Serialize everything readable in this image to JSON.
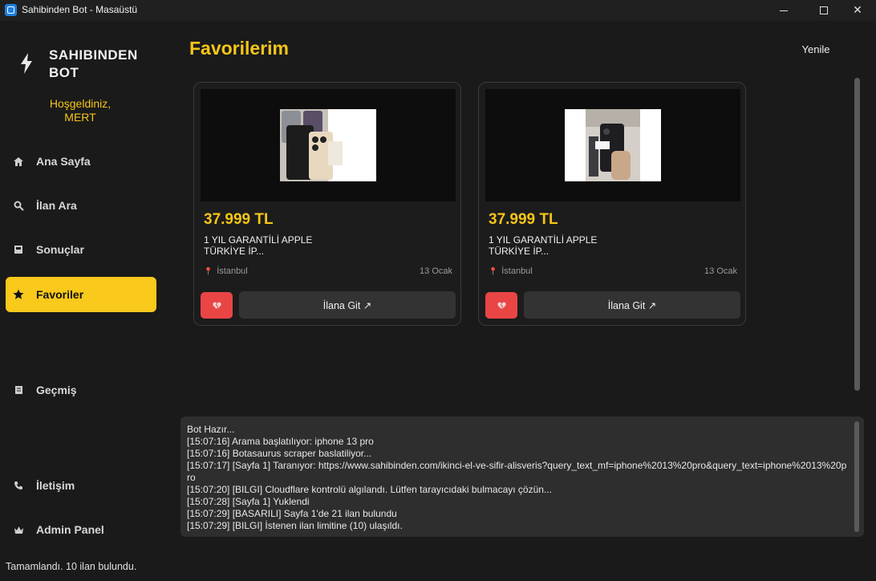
{
  "window": {
    "title": "Sahibinden Bot - Masaüstü"
  },
  "sidebar": {
    "logo_icon": "lightning-icon",
    "logo_line1": "SAHIBINDEN",
    "logo_line2": "BOT",
    "welcome_line1": "Hoşgeldiniz,",
    "welcome_line2": "MERT",
    "items": [
      {
        "label": "Ana Sayfa",
        "icon": "home-icon"
      },
      {
        "label": "İlan Ara",
        "icon": "search-icon"
      },
      {
        "label": "Sonuçlar",
        "icon": "inbox-icon"
      },
      {
        "label": "Favoriler",
        "icon": "star-icon",
        "active": true
      },
      {
        "label": "Geçmiş",
        "icon": "scroll-icon"
      },
      {
        "label": "İletişim",
        "icon": "phone-icon"
      },
      {
        "label": "Admin Panel",
        "icon": "crown-icon"
      }
    ],
    "status": "Tamamlandı. 10 ilan bulundu."
  },
  "main": {
    "title": "Favorilerim",
    "refresh_label": "Yenile",
    "cards": [
      {
        "price": "37.999 TL",
        "title_line1": "1 YIL GARANTİLİ APPLE",
        "title_line2": "TÜRKİYE İP...",
        "location": "İstanbul",
        "date": "13 Ocak",
        "remove_icon": "broken-heart-icon",
        "go_label": "İlana Git ↗"
      },
      {
        "price": "37.999 TL",
        "title_line1": "1 YIL GARANTİLİ APPLE",
        "title_line2": "TÜRKİYE İP...",
        "location": "İstanbul",
        "date": "13 Ocak",
        "remove_icon": "broken-heart-icon",
        "go_label": "İlana Git ↗"
      }
    ]
  },
  "log": {
    "lines": [
      "Bot Hazır...",
      "[15:07:16] Arama başlatılıyor: iphone 13 pro",
      "[15:07:16] Botasaurus scraper baslatiliyor...",
      "[15:07:17] [Sayfa 1] Taranıyor: https://www.sahibinden.com/ikinci-el-ve-sifir-alisveris?query_text_mf=iphone%2013%20pro&query_text=iphone%2013%20pro",
      "[15:07:20] [BILGI] Cloudflare kontrolü algılandı. Lütfen tarayıcıdaki bulmacayı çözün...",
      "[15:07:28] [Sayfa 1] Yuklendi",
      "[15:07:29] [BASARILI] Sayfa 1'de 21 ilan bulundu",
      "[15:07:29] [BILGI] İstenen ilan limitine (10) ulaşıldı."
    ]
  },
  "colors": {
    "accent": "#f9c91b",
    "danger": "#e94545",
    "background": "#1a1a1a"
  }
}
